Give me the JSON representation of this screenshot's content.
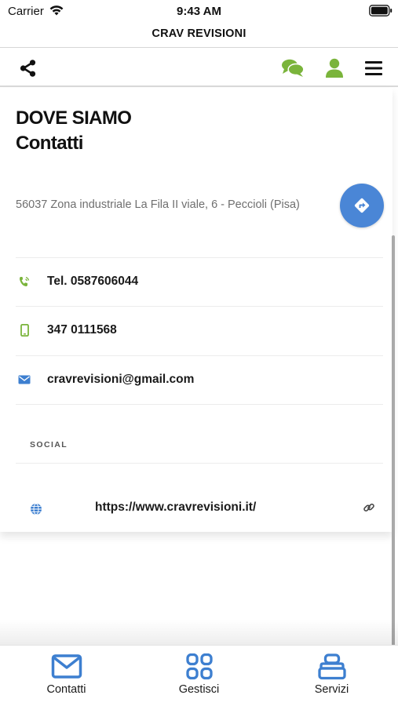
{
  "status_bar": {
    "carrier": "Carrier",
    "time": "9:43 AM"
  },
  "header": {
    "title": "CRAV REVISIONI"
  },
  "toolbar": {
    "icons": [
      "share-icon",
      "chat-icon",
      "user-icon",
      "menu-icon"
    ],
    "accent_color": "#7ab43b"
  },
  "page": {
    "title": "DOVE SIAMO",
    "subtitle": "Contatti",
    "address": "56037 Zona industriale La Fila II viale, 6 - Peccioli (Pisa)"
  },
  "contacts": {
    "phone": "Tel. 0587606044",
    "mobile": "347 0111568",
    "email": "cravrevisioni@gmail.com"
  },
  "social": {
    "header": "SOCIAL",
    "website": "https://www.cravrevisioni.it/"
  },
  "tabbar": {
    "accent_color": "#3d7fd0",
    "tabs": [
      {
        "label": "Contatti",
        "icon": "envelope-icon"
      },
      {
        "label": "Gestisci",
        "icon": "grid-icon"
      },
      {
        "label": "Servizi",
        "icon": "stack-icon"
      }
    ]
  }
}
